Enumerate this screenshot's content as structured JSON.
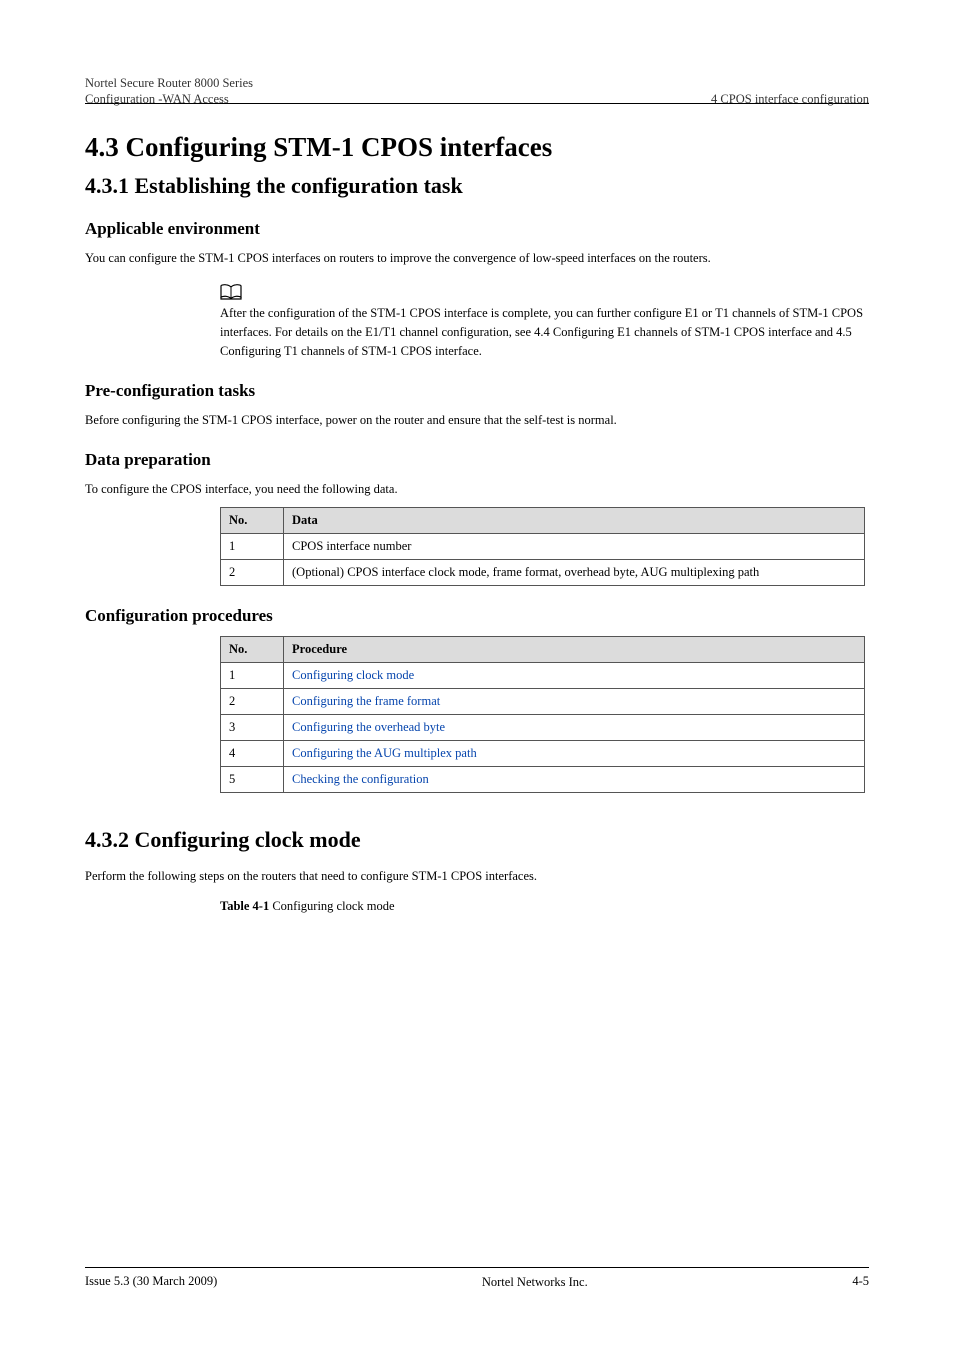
{
  "header": {
    "left_line1": "Nortel Secure Router 8000 Series",
    "left_line2": "Configuration -WAN Access",
    "right_line1": "4 CPOS interface configuration"
  },
  "section": {
    "title": "4.3 Configuring STM-1 CPOS interfaces",
    "sub_4_3_1": "4.3.1 Establishing the configuration task",
    "sub_4_3_2": "4.3.2 Configuring clock mode"
  },
  "applicable_env": {
    "heading": "Applicable environment",
    "para1": "You can configure the STM-1 CPOS interfaces on routers to improve the convergence of low-speed interfaces on the routers.",
    "note": "After the configuration of the STM-1 CPOS interface is complete, you can further configure E1 or T1 channels of STM-1 CPOS interfaces. For details on the E1/T1 channel configuration, see 4.4 Configuring E1 channels of STM-1 CPOS interface and 4.5 Configuring T1 channels of STM-1 CPOS interface."
  },
  "preconfig": {
    "heading": "Pre-configuration tasks",
    "para1": "Before configuring the STM-1 CPOS interface, power on the router and ensure that the self-test is normal."
  },
  "dataprep": {
    "heading": "Data preparation",
    "para1": "To configure the CPOS interface, you need the following data.",
    "table_header_no": "No.",
    "table_header_data": "Data",
    "rows": [
      {
        "no": "1",
        "data": "CPOS interface number"
      },
      {
        "no": "2",
        "data": "(Optional) CPOS interface clock mode, frame format, overhead byte, AUG multiplexing path"
      }
    ]
  },
  "configproc": {
    "heading": "Configuration procedures",
    "table_header_no": "No.",
    "table_header_proc": "Procedure",
    "rows": [
      {
        "no": "1",
        "proc": "Configuring clock mode"
      },
      {
        "no": "2",
        "proc": "Configuring the frame format"
      },
      {
        "no": "3",
        "proc": "Configuring the overhead byte"
      },
      {
        "no": "4",
        "proc": "Configuring the AUG multiplex path"
      },
      {
        "no": "5",
        "proc": "Checking the configuration"
      }
    ]
  },
  "clockmode": {
    "para1": "Perform the following steps on the routers that need to configure STM-1 CPOS interfaces.",
    "caption_num": "Table 4-1",
    "caption_text": " Configuring clock mode"
  },
  "footer": {
    "left": "Issue 5.3 (30 March 2009)",
    "center_line1": "Nortel Networks Inc.",
    "right": "4-5"
  }
}
